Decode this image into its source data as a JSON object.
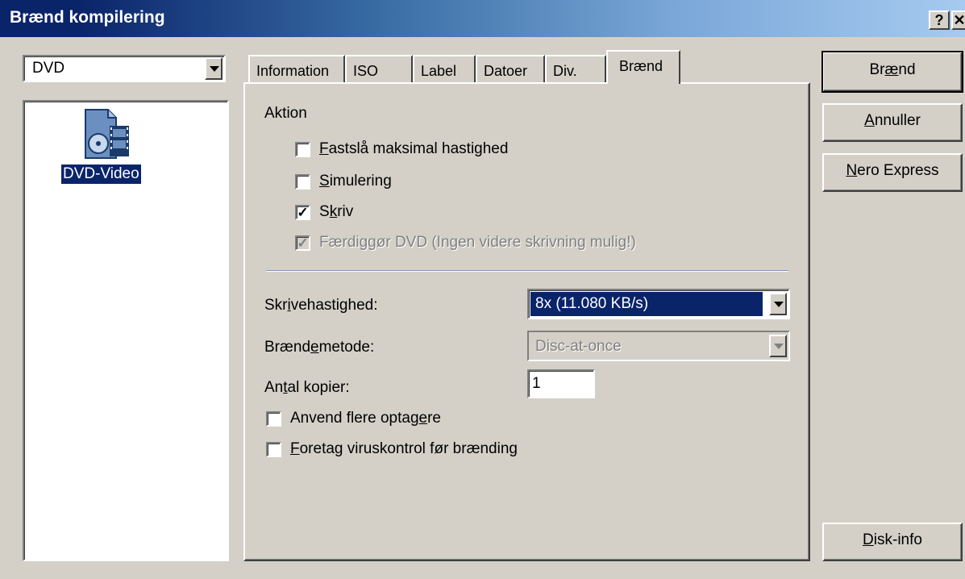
{
  "window": {
    "title": "Brænd kompilering",
    "help_glyph": "?",
    "close_glyph": "✕"
  },
  "left": {
    "combo_value": "DVD",
    "item_label": "DVD-Video"
  },
  "tabs": [
    {
      "label": "Information"
    },
    {
      "label": "ISO"
    },
    {
      "label": "Label"
    },
    {
      "label": "Datoer"
    },
    {
      "label": "Div."
    },
    {
      "label": "Brænd"
    }
  ],
  "action": {
    "group_label": "Aktion",
    "options": [
      {
        "pre": "",
        "u": "F",
        "post": "astslå maksimal hastighed",
        "checked": false,
        "disabled": false
      },
      {
        "pre": "",
        "u": "S",
        "post": "imulering",
        "checked": false,
        "disabled": false
      },
      {
        "pre": "S",
        "u": "k",
        "post": "riv",
        "checked": true,
        "disabled": false
      },
      {
        "pre": "",
        "u": "",
        "post": "Færdiggør DVD (Ingen videre skrivning mulig!)",
        "checked": true,
        "disabled": true
      }
    ]
  },
  "fields": {
    "speed_pre": "Skr",
    "speed_u": "i",
    "speed_post": "vehastighed:",
    "speed_value": "8x (11.080 KB/s)",
    "method_pre": "Brænd",
    "method_u": "e",
    "method_post": "metode:",
    "method_value": "Disc-at-once",
    "copies_pre": "An",
    "copies_u": "t",
    "copies_post": "al kopier:",
    "copies_value": "1"
  },
  "extra": [
    {
      "pre": "Anvend flere optag",
      "u": "e",
      "post": "re",
      "checked": false
    },
    {
      "pre": "",
      "u": "F",
      "post": "oretag viruskontrol før brænding",
      "checked": false
    }
  ],
  "buttons": {
    "burn_pre": "Br",
    "burn_u": "æ",
    "burn_post": "nd",
    "cancel_pre": "",
    "cancel_u": "A",
    "cancel_post": "nnuller",
    "express_pre": "",
    "express_u": "N",
    "express_post": "ero Express",
    "diskinfo_pre": "",
    "diskinfo_u": "D",
    "diskinfo_post": "isk-info"
  }
}
